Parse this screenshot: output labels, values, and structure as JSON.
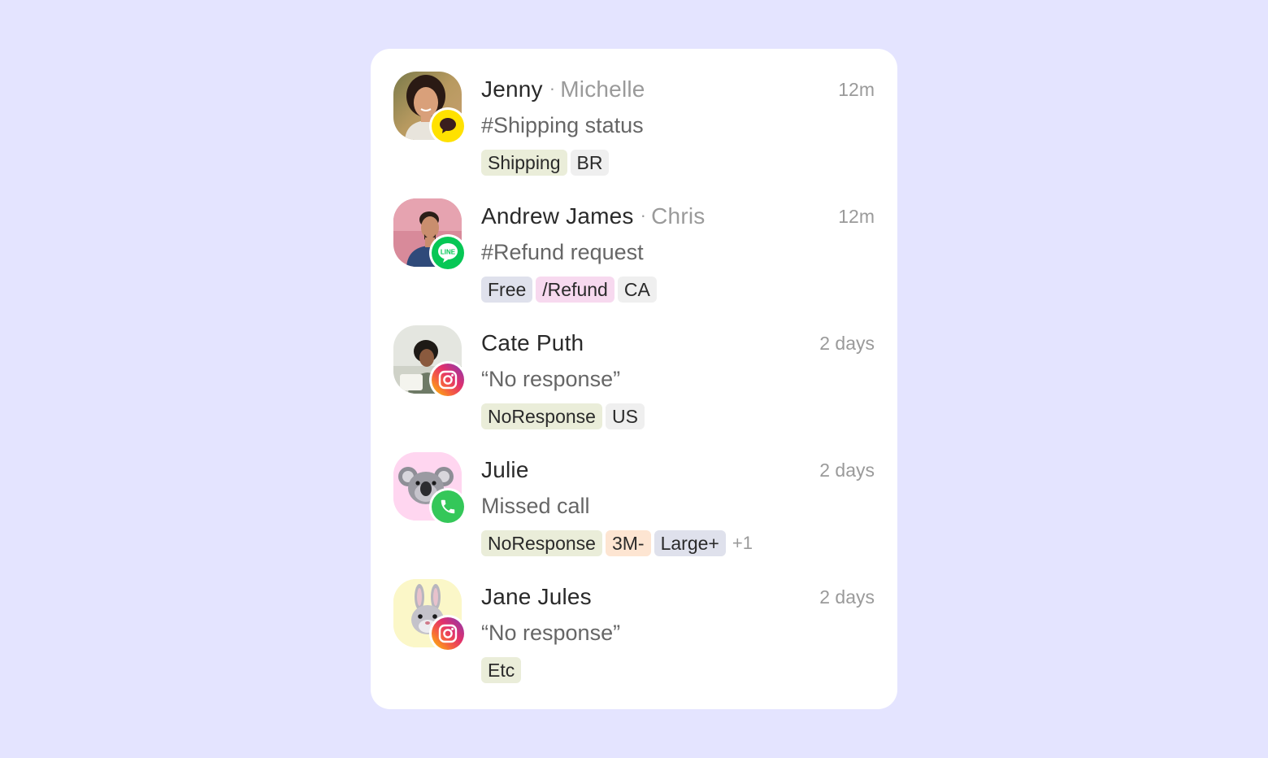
{
  "conversations": [
    {
      "name": "Jenny",
      "agent": "Michelle",
      "time": "12m",
      "message": "#Shipping status",
      "channel_icon": "kakaotalk-icon",
      "tags": [
        {
          "label": "Shipping",
          "color": "#eaedd9"
        },
        {
          "label": "BR",
          "color": "#efefef"
        }
      ],
      "more": ""
    },
    {
      "name": "Andrew James",
      "agent": "Chris",
      "time": "12m",
      "message": "#Refund request",
      "channel_icon": "line-icon",
      "channel_label": "LINE",
      "tags": [
        {
          "label": "Free",
          "color": "#dfe1ec"
        },
        {
          "label": "/Refund",
          "color": "#f7d9ef"
        },
        {
          "label": "CA",
          "color": "#efefef"
        }
      ],
      "more": ""
    },
    {
      "name": "Cate Puth",
      "agent": "",
      "time": "2 days",
      "message": "“No response”",
      "channel_icon": "instagram-icon",
      "tags": [
        {
          "label": "NoResponse",
          "color": "#eaedd9"
        },
        {
          "label": "US",
          "color": "#efefef"
        }
      ],
      "more": ""
    },
    {
      "name": "Julie",
      "agent": "",
      "time": "2 days",
      "message": "Missed call",
      "channel_icon": "phone-icon",
      "tags": [
        {
          "label": "NoResponse",
          "color": "#eaedd9"
        },
        {
          "label": "3M-",
          "color": "#fde5d2"
        },
        {
          "label": "Large+",
          "color": "#dfe1ec"
        }
      ],
      "more": "+1"
    },
    {
      "name": "Jane Jules",
      "agent": "",
      "time": "2 days",
      "message": "“No response”",
      "channel_icon": "instagram-icon",
      "tags": [
        {
          "label": "Etc",
          "color": "#eaedd9"
        }
      ],
      "more": ""
    }
  ],
  "colors": {
    "background": "#e4e4ff",
    "kakao": "#ffe100",
    "line": "#06c755",
    "phone": "#34c759",
    "koala_bg": "#ffd6f0",
    "bunny_bg": "#fbf7c8"
  }
}
